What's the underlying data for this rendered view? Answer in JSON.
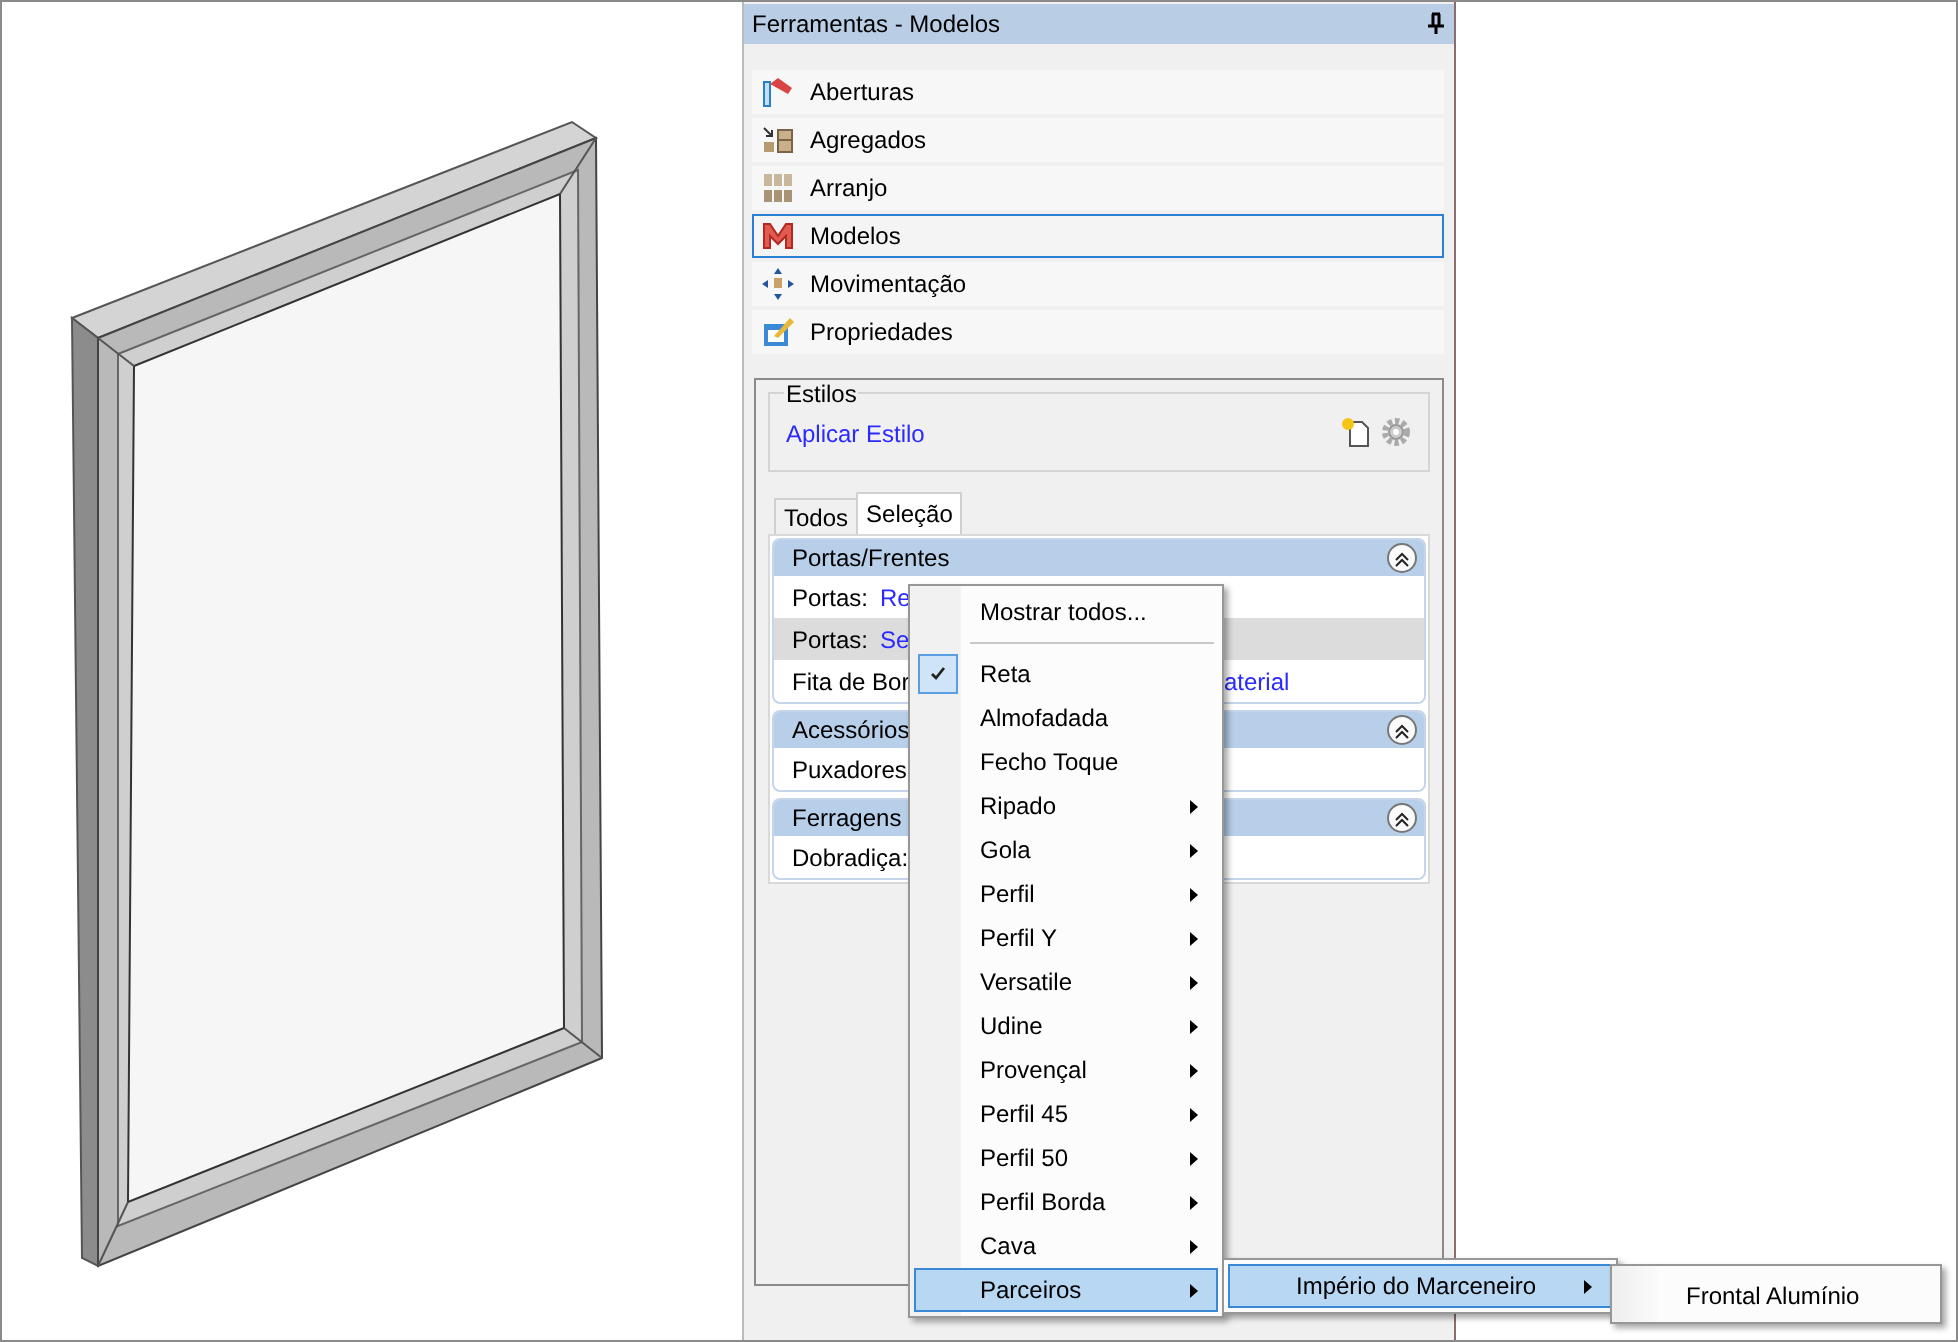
{
  "window": {
    "title": "Ferramentas - Modelos"
  },
  "tools": [
    {
      "label": "Aberturas",
      "selected": false
    },
    {
      "label": "Agregados",
      "selected": false
    },
    {
      "label": "Arranjo",
      "selected": false
    },
    {
      "label": "Modelos",
      "selected": true
    },
    {
      "label": "Movimentação",
      "selected": false
    },
    {
      "label": "Propriedades",
      "selected": false
    }
  ],
  "styles": {
    "legend": "Estilos",
    "link": "Aplicar Estilo"
  },
  "tabs": [
    {
      "label": "Todos",
      "selected": false
    },
    {
      "label": "Seleção",
      "selected": true
    }
  ],
  "groups": [
    {
      "title": "Portas/Frentes",
      "expanded": true,
      "rows": [
        {
          "kind": "inline",
          "label": "Portas:",
          "value": "Re",
          "selected": false
        },
        {
          "kind": "inline",
          "label": "Portas:",
          "value": "Se",
          "selected": true
        },
        {
          "kind": "tail",
          "label": "Fita de Bor",
          "value": "aterial",
          "selected": false
        }
      ]
    },
    {
      "title": "Acessórios",
      "expanded": true,
      "rows": [
        {
          "kind": "inline",
          "label": "Puxadores",
          "selected": false
        }
      ]
    },
    {
      "title": "Ferragens",
      "expanded": true,
      "rows": [
        {
          "kind": "inline",
          "label": "Dobradiça:",
          "selected": false
        }
      ]
    }
  ],
  "context_menu": {
    "items": [
      {
        "kind": "item",
        "label": "Mostrar todos...",
        "checked": false,
        "submenu": false,
        "selected": false
      },
      {
        "kind": "separator"
      },
      {
        "kind": "item",
        "label": "Reta",
        "checked": true,
        "submenu": false,
        "selected": false
      },
      {
        "kind": "item",
        "label": "Almofadada",
        "checked": false,
        "submenu": false,
        "selected": false
      },
      {
        "kind": "item",
        "label": "Fecho Toque",
        "checked": false,
        "submenu": false,
        "selected": false
      },
      {
        "kind": "item",
        "label": "Ripado",
        "checked": false,
        "submenu": true,
        "selected": false
      },
      {
        "kind": "item",
        "label": "Gola",
        "checked": false,
        "submenu": true,
        "selected": false
      },
      {
        "kind": "item",
        "label": "Perfil",
        "checked": false,
        "submenu": true,
        "selected": false
      },
      {
        "kind": "item",
        "label": "Perfil Y",
        "checked": false,
        "submenu": true,
        "selected": false
      },
      {
        "kind": "item",
        "label": "Versatile",
        "checked": false,
        "submenu": true,
        "selected": false
      },
      {
        "kind": "item",
        "label": "Udine",
        "checked": false,
        "submenu": true,
        "selected": false
      },
      {
        "kind": "item",
        "label": "Provençal",
        "checked": false,
        "submenu": true,
        "selected": false
      },
      {
        "kind": "item",
        "label": "Perfil 45",
        "checked": false,
        "submenu": true,
        "selected": false
      },
      {
        "kind": "item",
        "label": "Perfil 50",
        "checked": false,
        "submenu": true,
        "selected": false
      },
      {
        "kind": "item",
        "label": "Perfil Borda",
        "checked": false,
        "submenu": true,
        "selected": false
      },
      {
        "kind": "item",
        "label": "Cava",
        "checked": false,
        "submenu": true,
        "selected": false
      },
      {
        "kind": "item",
        "label": "Parceiros",
        "checked": false,
        "submenu": true,
        "selected": true
      }
    ]
  },
  "submenu": {
    "items": [
      {
        "kind": "item",
        "label": "Império do Marceneiro",
        "checked": false,
        "submenu": true,
        "selected": true
      }
    ]
  },
  "submenu_2": {
    "items": [
      {
        "kind": "item",
        "label": "Frontal Alumínio",
        "checked": false,
        "submenu": false,
        "selected": false
      }
    ]
  }
}
